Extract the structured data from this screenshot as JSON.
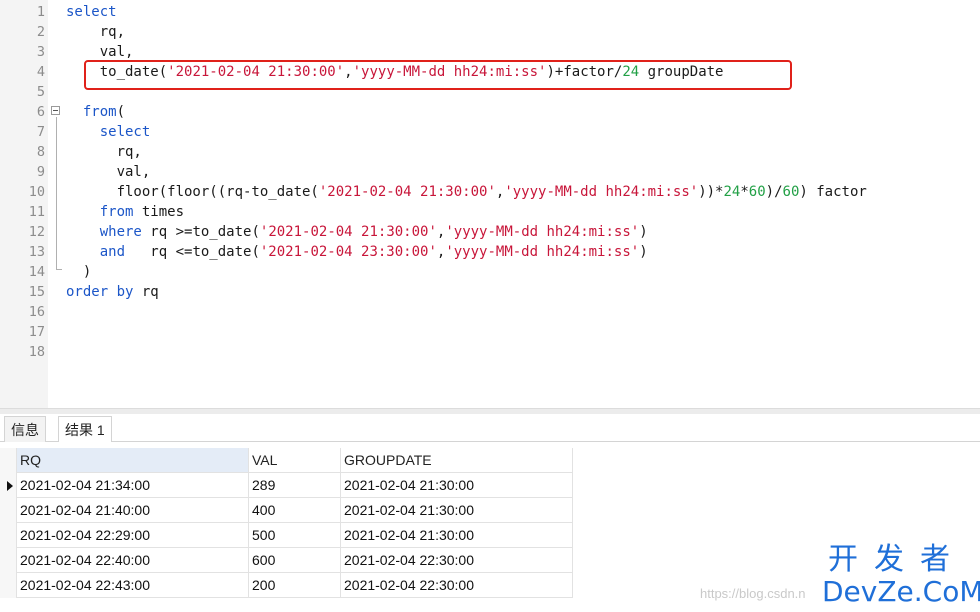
{
  "editor": {
    "line_numbers": [
      "1",
      "2",
      "3",
      "4",
      "5",
      "6",
      "7",
      "8",
      "9",
      "10",
      "11",
      "12",
      "13",
      "14",
      "15",
      "16",
      "17",
      "18"
    ],
    "lines": [
      [
        {
          "t": "kw",
          "v": "select"
        }
      ],
      [
        {
          "t": "p",
          "v": "    rq,"
        }
      ],
      [
        {
          "t": "p",
          "v": "    val,"
        }
      ],
      [
        {
          "t": "p",
          "v": "    to_date("
        },
        {
          "t": "str",
          "v": "'2021-02-04 21:30:00'"
        },
        {
          "t": "p",
          "v": ","
        },
        {
          "t": "str",
          "v": "'yyyy-MM-dd hh24:mi:ss'"
        },
        {
          "t": "p",
          "v": ")+factor/"
        },
        {
          "t": "num",
          "v": "24"
        },
        {
          "t": "p",
          "v": " groupDate"
        }
      ],
      [],
      [
        {
          "t": "p",
          "v": "  "
        },
        {
          "t": "kw",
          "v": "from"
        },
        {
          "t": "p",
          "v": "("
        }
      ],
      [
        {
          "t": "p",
          "v": "    "
        },
        {
          "t": "kw",
          "v": "select"
        }
      ],
      [
        {
          "t": "p",
          "v": "      rq,"
        }
      ],
      [
        {
          "t": "p",
          "v": "      val,"
        }
      ],
      [
        {
          "t": "p",
          "v": "      floor(floor((rq-to_date("
        },
        {
          "t": "str",
          "v": "'2021-02-04 21:30:00'"
        },
        {
          "t": "p",
          "v": ","
        },
        {
          "t": "str",
          "v": "'yyyy-MM-dd hh24:mi:ss'"
        },
        {
          "t": "p",
          "v": "))*"
        },
        {
          "t": "num",
          "v": "24"
        },
        {
          "t": "p",
          "v": "*"
        },
        {
          "t": "num",
          "v": "60"
        },
        {
          "t": "p",
          "v": ")/"
        },
        {
          "t": "num",
          "v": "60"
        },
        {
          "t": "p",
          "v": ") factor"
        }
      ],
      [
        {
          "t": "p",
          "v": "    "
        },
        {
          "t": "kw",
          "v": "from"
        },
        {
          "t": "p",
          "v": " times"
        }
      ],
      [
        {
          "t": "p",
          "v": "    "
        },
        {
          "t": "kw",
          "v": "where"
        },
        {
          "t": "p",
          "v": " rq >=to_date("
        },
        {
          "t": "str",
          "v": "'2021-02-04 21:30:00'"
        },
        {
          "t": "p",
          "v": ","
        },
        {
          "t": "str",
          "v": "'yyyy-MM-dd hh24:mi:ss'"
        },
        {
          "t": "p",
          "v": ")"
        }
      ],
      [
        {
          "t": "p",
          "v": "    "
        },
        {
          "t": "kw",
          "v": "and"
        },
        {
          "t": "p",
          "v": "   rq <=to_date("
        },
        {
          "t": "str",
          "v": "'2021-02-04 23:30:00'"
        },
        {
          "t": "p",
          "v": ","
        },
        {
          "t": "str",
          "v": "'yyyy-MM-dd hh24:mi:ss'"
        },
        {
          "t": "p",
          "v": ")"
        }
      ],
      [
        {
          "t": "p",
          "v": "  )"
        }
      ],
      [
        {
          "t": "kw",
          "v": "order by"
        },
        {
          "t": "p",
          "v": " rq"
        }
      ],
      [],
      [],
      []
    ],
    "highlight_color": "#e0211a",
    "keyword_color": "#1c56c8",
    "string_color": "#c8163a",
    "number_color": "#22a046"
  },
  "tabs": [
    {
      "label": "信息",
      "active": false
    },
    {
      "label": "结果 1",
      "active": true
    }
  ],
  "results": {
    "columns": [
      "RQ",
      "VAL",
      "GROUPDATE"
    ],
    "rows": [
      [
        "2021-02-04 21:34:00",
        "289",
        "2021-02-04 21:30:00"
      ],
      [
        "2021-02-04 21:40:00",
        "400",
        "2021-02-04 21:30:00"
      ],
      [
        "2021-02-04 22:29:00",
        "500",
        "2021-02-04 21:30:00"
      ],
      [
        "2021-02-04 22:40:00",
        "600",
        "2021-02-04 22:30:00"
      ],
      [
        "2021-02-04 22:43:00",
        "200",
        "2021-02-04 22:30:00"
      ]
    ],
    "current_row": 1
  },
  "watermark": {
    "url": "https://blog.csdn.n",
    "logo_cn": "开发者",
    "logo_en": "DevZe.CoM"
  }
}
